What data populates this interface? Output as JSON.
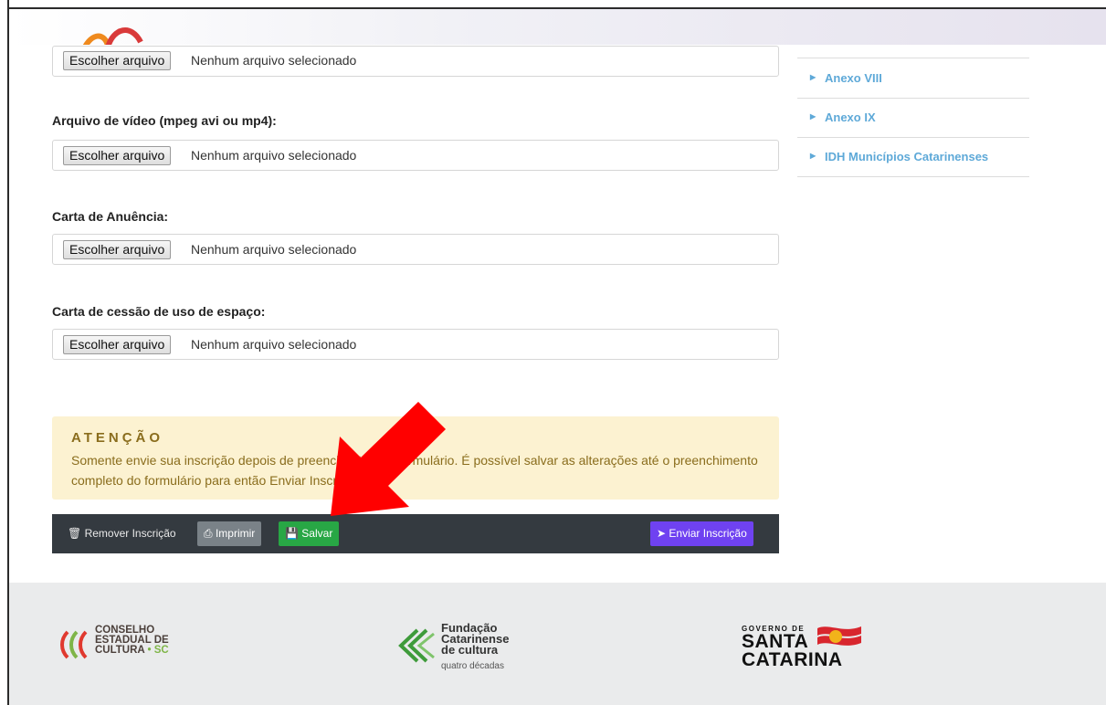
{
  "form": {
    "field_top": {
      "button_label": "Escolher arquivo",
      "status": "Nenhum arquivo selecionado"
    },
    "fields": [
      {
        "label": "Arquivo de vídeo (mpeg avi ou mp4):",
        "button_label": "Escolher arquivo",
        "status": "Nenhum arquivo selecionado"
      },
      {
        "label": "Carta de Anuência:",
        "button_label": "Escolher arquivo",
        "status": "Nenhum arquivo selecionado"
      },
      {
        "label": "Carta de cessão de uso de espaço:",
        "button_label": "Escolher arquivo",
        "status": "Nenhum arquivo selecionado"
      }
    ]
  },
  "sidebar": {
    "links": [
      {
        "label": "Anexo VIII"
      },
      {
        "label": "Anexo IX"
      },
      {
        "label": "IDH Municípios Catarinenses"
      }
    ]
  },
  "alert": {
    "title": "ATENÇÃO",
    "text": "Somente envie sua inscrição depois de preencher todo o formulário. É possível salvar as alterações até o preenchimento completo do formulário para então Enviar Inscrição."
  },
  "actions": {
    "remove_label": "Remover Inscrição",
    "print_label": "Imprimir",
    "save_label": "Salvar",
    "send_label": "Enviar Inscrição"
  },
  "footer": {
    "cesc": {
      "line1": "CONSELHO",
      "line2": "ESTADUAL DE",
      "line3": "CULTURA",
      "suffix": "• SC"
    },
    "fcc": {
      "line1": "Fundação",
      "line2": "Catarinense",
      "line3": "de cultura",
      "sub": "quatro décadas"
    },
    "gov": {
      "small": "GOVERNO DE",
      "line1": "SANTA",
      "line2": "CATARINA"
    }
  },
  "colors": {
    "accent_link": "#5ea9d8",
    "alert_bg": "#fcf2d1",
    "alert_text": "#8a6d1d",
    "actionbar_bg": "#343a40",
    "print_btn": "#7a8288",
    "save_btn": "#28a745",
    "send_btn": "#6f42f1",
    "arrow": "#ff0000"
  },
  "icons": {
    "sidebar_bullet": "caret-right-icon",
    "remove": "trash-icon",
    "print": "printer-icon",
    "save": "floppy-disk-icon",
    "send": "paper-plane-icon",
    "annotation": "red-arrow-annotation"
  }
}
